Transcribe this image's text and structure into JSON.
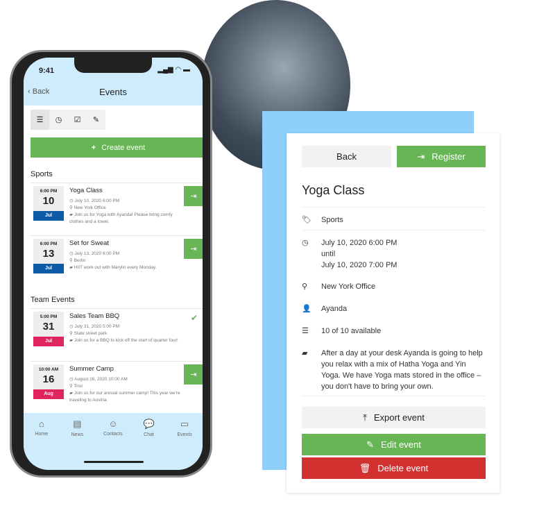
{
  "phone": {
    "time": "9:41",
    "back": "Back",
    "title": "Events",
    "create": "Create event",
    "sections": [
      {
        "title": "Sports"
      },
      {
        "title": "Team Events"
      }
    ],
    "events": [
      {
        "time": "6:00 PM",
        "day": "10",
        "month": "Jul",
        "month_color": "#0d5aa6",
        "name": "Yoga Class",
        "date": "July 10, 2020 6:00 PM",
        "location": "New York Office",
        "desc": "Join us for Yoga with Ayanda! Please bring comfy clothes and a towel.",
        "registered": false
      },
      {
        "time": "6:00 PM",
        "day": "13",
        "month": "Jul",
        "month_color": "#0d5aa6",
        "name": "Set for Sweat",
        "date": "July 13, 2020 6:00 PM",
        "location": "Berlin",
        "desc": "HIIT work out with Marylin every Monday.",
        "registered": false
      },
      {
        "time": "5:00 PM",
        "day": "31",
        "month": "Jul",
        "month_color": "#e0245e",
        "name": "Sales Team BBQ",
        "date": "July 31, 2020 5:00 PM",
        "location": "State street park",
        "desc": "Join us for a BBQ to kick off the start of quarter four!",
        "registered": true
      },
      {
        "time": "10:00 AM",
        "day": "16",
        "month": "Aug",
        "month_color": "#e0245e",
        "name": "Summer Camp",
        "date": "August 16, 2020 10:00 AM",
        "location": "Tirol",
        "desc": "Join us for our annual summer camp! This year we're traveling to Austria.",
        "registered": false
      }
    ],
    "tabs": [
      {
        "label": "Home",
        "icon": "home-icon"
      },
      {
        "label": "News",
        "icon": "news-icon"
      },
      {
        "label": "Contacts",
        "icon": "contacts-icon"
      },
      {
        "label": "Chat",
        "icon": "chat-icon"
      },
      {
        "label": "Events",
        "icon": "folder-icon"
      }
    ]
  },
  "detail": {
    "back": "Back",
    "register": "Register",
    "title": "Yoga Class",
    "category": "Sports",
    "start": "July 10, 2020 6:00 PM",
    "until": "until",
    "end": "July 10, 2020 7:00 PM",
    "location": "New York Office",
    "host": "Ayanda",
    "availability": "10 of 10 available",
    "description": "After a day at your desk Ayanda is going to help you relax with a mix of Hatha Yoga and Yin Yoga. We have Yoga mats stored in the office – you don't have to bring your own.",
    "export": "Export event",
    "edit": "Edit event",
    "delete": "Delete event"
  },
  "colors": {
    "green": "#67b554",
    "red": "#d33030",
    "light_blue": "#cfecfc"
  }
}
